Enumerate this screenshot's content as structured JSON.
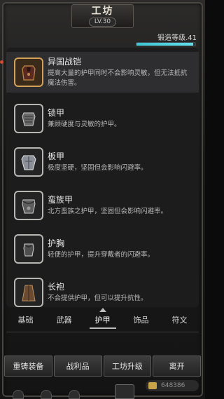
{
  "header": {
    "title": "工坊",
    "level": "LV.30",
    "forge_label": "锻造等级.41",
    "forge_progress": 0.97
  },
  "items": [
    {
      "name": "异国战铠",
      "desc": "提高大量的护甲同时不会影响灵敏，但无法抵抗魔法伤害。",
      "icon": "exotic-armor-icon"
    },
    {
      "name": "锁甲",
      "desc": "兼顾硬度与灵敏的护甲。",
      "icon": "chainmail-icon"
    },
    {
      "name": "板甲",
      "desc": "极度坚硬，坚固但会影响闪避率。",
      "icon": "plate-armor-icon"
    },
    {
      "name": "蛮族甲",
      "desc": "北方蛮族之护甲，坚固但会影响闪避率。",
      "icon": "barbarian-armor-icon"
    },
    {
      "name": "护胸",
      "desc": "轻便的护甲，提升穿戴者的闪避率。",
      "icon": "breastplate-icon"
    },
    {
      "name": "长袍",
      "desc": "不会提供护甲，但可以提升抗性。",
      "icon": "robe-icon"
    }
  ],
  "tabs": [
    "基础",
    "武器",
    "护甲",
    "饰品",
    "符文"
  ],
  "active_tab": "护甲",
  "actions": [
    "重铸装备",
    "战利品",
    "工坊升级",
    "离开"
  ],
  "gold": "648386",
  "colors": {
    "accent": "#61e0ea",
    "selected_border": "#d4a15a"
  }
}
